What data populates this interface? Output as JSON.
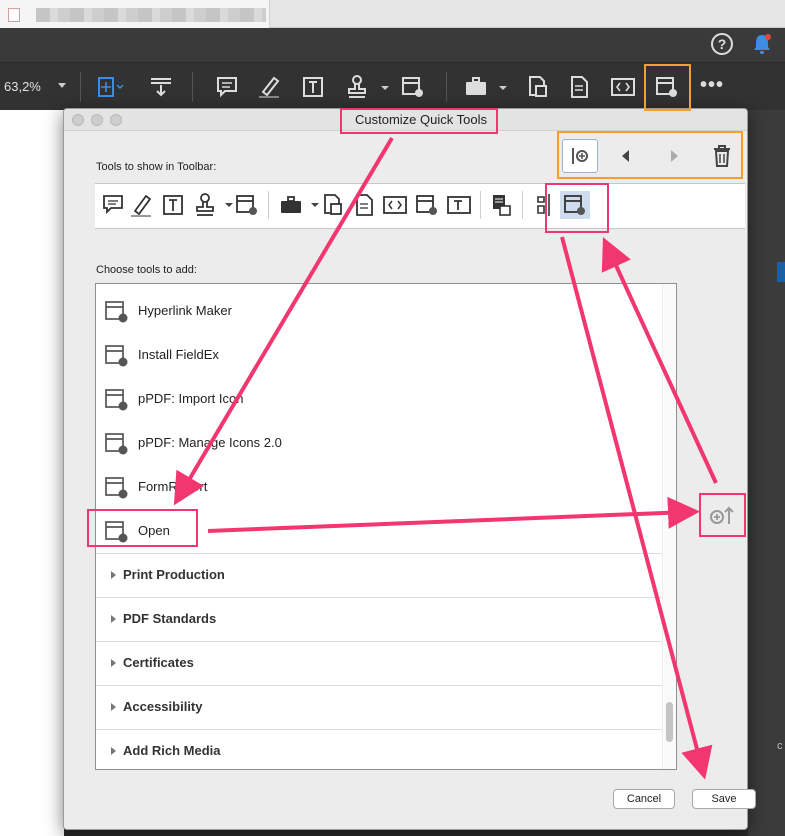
{
  "window": {
    "tab_title": ""
  },
  "toolbar": {
    "zoom": "63,2%"
  },
  "dialog": {
    "title": "Customize Quick Tools",
    "toolbar_label": "Tools to show in Toolbar:",
    "choose_label": "Choose tools to add:",
    "items": [
      {
        "label": "Hyperlink Maker",
        "icon": "tool-gear-icon"
      },
      {
        "label": "Install FieldEx",
        "icon": "tool-gear-icon"
      },
      {
        "label": "pPDF: Import Icon",
        "icon": "tool-gear-icon"
      },
      {
        "label": "pPDF: Manage Icons 2.0",
        "icon": "tool-gear-icon"
      },
      {
        "label": "FormReport",
        "icon": "tool-gear-icon"
      },
      {
        "label": "Open",
        "icon": "tool-gear-icon"
      }
    ],
    "categories": [
      {
        "label": "Print Production"
      },
      {
        "label": "PDF Standards"
      },
      {
        "label": "Certificates"
      },
      {
        "label": "Accessibility"
      },
      {
        "label": "Add Rich Media"
      }
    ],
    "cancel_label": "Cancel",
    "save_label": "Save"
  },
  "colors": {
    "annotation_pink": "#f2366f",
    "annotation_orange": "#f4a02a",
    "accent_blue": "#3a8ee6",
    "notification_red": "#e0483e"
  }
}
